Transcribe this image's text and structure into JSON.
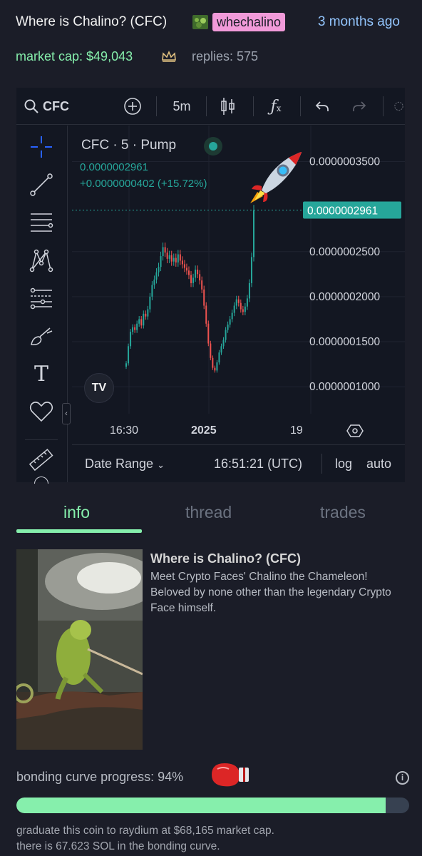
{
  "header": {
    "title": "Where is Chalino? (CFC)",
    "creator": "whechalino",
    "created_ago": "3 months ago",
    "market_cap": "market cap: $49,043",
    "replies": "replies: 575"
  },
  "chart": {
    "toolbar": {
      "symbol": "CFC",
      "interval": "5m"
    },
    "legend": {
      "symbol_line": "CFC · 5 · Pump",
      "price": "0.0000002961",
      "change": "+0.0000000402 (+15.72%)"
    },
    "last_price_label": "0.0000002961",
    "bottom": {
      "date_range": "Date Range",
      "time": "16:51:21 (UTC)",
      "log": "log",
      "auto": "auto"
    }
  },
  "chart_data": {
    "type": "candlestick",
    "symbol": "CFC",
    "interval": "5m",
    "last_price": 2.961e-07,
    "change": 4.02e-08,
    "change_pct": 15.72,
    "y_ticks": [
      "0.0000003500",
      "0.0000002500",
      "0.0000002000",
      "0.0000001500",
      "0.0000001000"
    ],
    "y_tick_values": [
      3.5e-07,
      2.5e-07,
      2e-07,
      1.5e-07,
      1e-07
    ],
    "x_ticks": [
      "16:30",
      "2025",
      "19"
    ],
    "ylim": [
      7e-08,
      3.9e-07
    ],
    "series": [
      {
        "name": "CFC",
        "closes": [
          1.26e-07,
          1.45e-07,
          1.61e-07,
          1.66e-07,
          1.63e-07,
          1.7e-07,
          1.75e-07,
          1.68e-07,
          1.81e-07,
          1.78e-07,
          1.86e-07,
          2e-07,
          2.13e-07,
          2.19e-07,
          2.27e-07,
          2.33e-07,
          2.45e-07,
          2.55e-07,
          2.49e-07,
          2.42e-07,
          2.46e-07,
          2.39e-07,
          2.43e-07,
          2.38e-07,
          2.47e-07,
          2.4e-07,
          2.36e-07,
          2.32e-07,
          2.29e-07,
          2.24e-07,
          2.15e-07,
          2.21e-07,
          2.3e-07,
          2.25e-07,
          2.18e-07,
          2.08e-07,
          1.9e-07,
          1.7e-07,
          1.48e-07,
          1.32e-07,
          1.21e-07,
          1.18e-07,
          1.27e-07,
          1.38e-07,
          1.45e-07,
          1.52e-07,
          1.63e-07,
          1.69e-07,
          1.75e-07,
          1.82e-07,
          1.9e-07,
          1.97e-07,
          1.93e-07,
          1.86e-07,
          1.83e-07,
          1.89e-07,
          1.98e-07,
          2.15e-07,
          2.44e-07,
          2.96e-07
        ]
      }
    ]
  },
  "tabs": [
    {
      "label": "info",
      "active": true
    },
    {
      "label": "thread",
      "active": false
    },
    {
      "label": "trades",
      "active": false
    }
  ],
  "info": {
    "name": "Where is Chalino? (CFC)",
    "description": "Meet Crypto Faces' Chalino the Chameleon! Beloved by none other than the legendary Crypto Face himself."
  },
  "bonding": {
    "label": "bonding curve progress: 94%",
    "progress": 0.94,
    "graduate_text": "graduate this coin to raydium at $68,165 market cap.",
    "sol_text": "there is 67.623 SOL in the bonding curve."
  },
  "colors": {
    "background": "#1b1d28",
    "accent_green": "#86efac",
    "creator_badge": "#f19ad9",
    "candle_up": "#26a69a",
    "candle_down": "#ef5350",
    "link_blue": "#93c5fd"
  },
  "icons": [
    "search-icon",
    "add-indicator-icon",
    "candles-icon",
    "formula-icon",
    "undo-icon",
    "redo-icon",
    "crosshair-icon",
    "trendline-icon",
    "fib-icon",
    "pattern-icon",
    "projection-icon",
    "brush-icon",
    "text-icon",
    "heart-icon",
    "ruler-icon",
    "settings-icon",
    "info-icon"
  ]
}
